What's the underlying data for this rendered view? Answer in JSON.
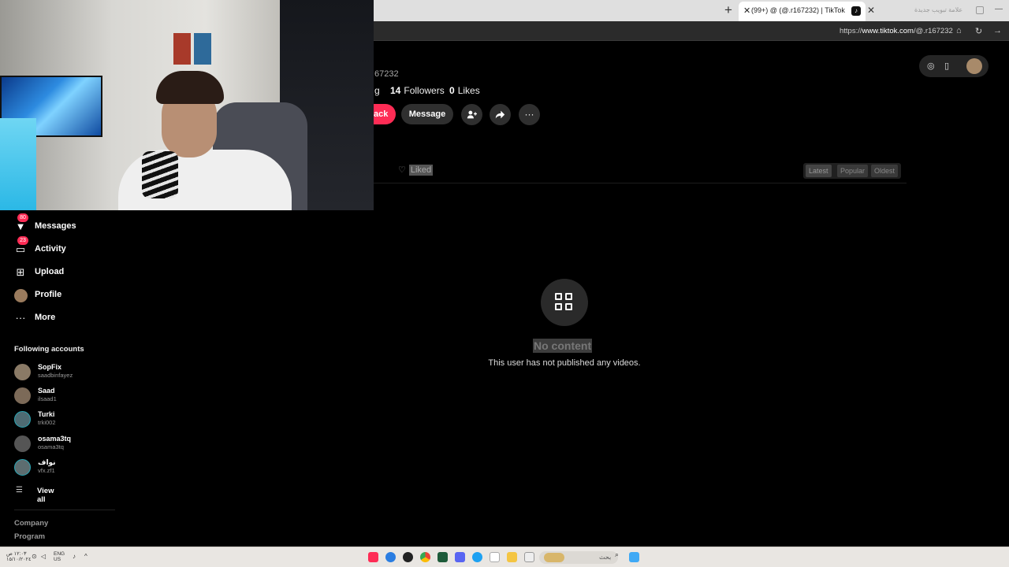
{
  "browser": {
    "active_tab_title": "(99+) ‪‪@ (@.r167232) | TikTok",
    "inactive_tab_title": "علامة تبويب جديدة",
    "url_prefix": "https://",
    "url_host": "www.tiktok.com",
    "url_path": "/@.r167232",
    "new_tab_glyph": "+",
    "close_glyph": "✕"
  },
  "profile": {
    "handle_fragment": "67232",
    "following_fragment": "g",
    "followers_count": "14",
    "followers_label": "Followers",
    "likes_count": "0",
    "likes_label": "Likes",
    "follow_back_fragment": "ack",
    "message_label": "Message"
  },
  "content_tabs": {
    "liked_label": "Liked",
    "sort": [
      "Latest",
      "Popular",
      "Oldest"
    ]
  },
  "empty_state": {
    "title": "No content",
    "subtitle": "This user has not published any videos."
  },
  "sidebar": {
    "nav": [
      {
        "label": "Messages",
        "badge": "80",
        "icon": "send-icon"
      },
      {
        "label": "Activity",
        "badge": "23",
        "icon": "inbox-icon"
      },
      {
        "label": "Upload",
        "icon": "plus-square-icon"
      },
      {
        "label": "Profile",
        "icon": "avatar-icon"
      },
      {
        "label": "More",
        "icon": "ellipsis-icon"
      }
    ],
    "following_title": "Following accounts",
    "accounts": [
      {
        "name": "SopFix",
        "username": "saadbinfayez"
      },
      {
        "name": "Saad",
        "username": "ilsaad1"
      },
      {
        "name": "Turki",
        "username": "trki002"
      },
      {
        "name": "osama3tq",
        "username": "osama3tq"
      },
      {
        "name": "نواف",
        "username": "vfx.zf1"
      }
    ],
    "view_all": "View all",
    "footer": [
      "Company",
      "Program"
    ]
  },
  "taskbar": {
    "time": "١٢:٠٣ ص",
    "date": "١٥/١٠/٢٠٢٤",
    "lang_top": "ENG",
    "lang_bottom": "US",
    "search_label": "بحث"
  },
  "colors": {
    "accent": "#fe2c55",
    "background": "#000000"
  }
}
